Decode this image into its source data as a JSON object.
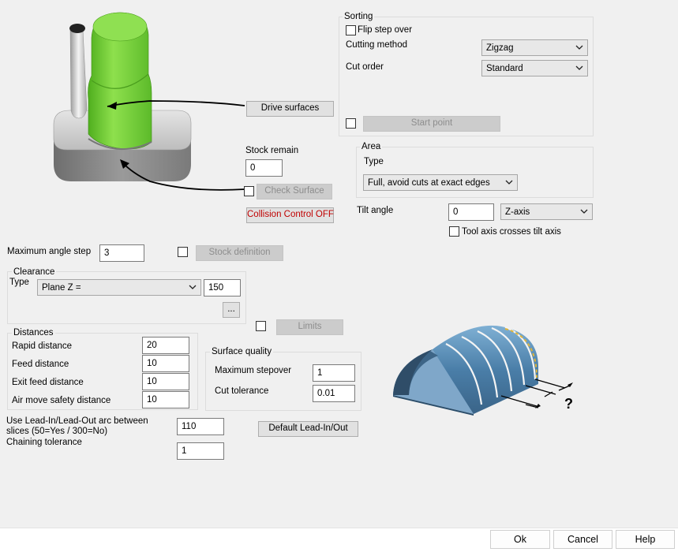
{
  "sorting": {
    "title": "Sorting",
    "flip_step_over": "Flip step over",
    "cutting_method_label": "Cutting method",
    "cutting_method_value": "Zigzag",
    "cut_order_label": "Cut order",
    "cut_order_value": "Standard",
    "start_point_button": "Start point"
  },
  "drive_surfaces_button": "Drive surfaces",
  "stock_remain": {
    "label": "Stock remain",
    "value": "0"
  },
  "check_surface_button": "Check Surface",
  "collision_control_button": "Collision Control OFF",
  "area": {
    "title": "Area",
    "type_label": "Type",
    "type_value": "Full, avoid cuts at exact edges"
  },
  "tilt": {
    "label": "Tilt angle",
    "value": "0",
    "axis_value": "Z-axis",
    "crosses_label": "Tool axis crosses tilt axis"
  },
  "max_angle_step": {
    "label": "Maximum angle step",
    "value": "3"
  },
  "stock_definition_button": "Stock definition",
  "clearance": {
    "title": "Clearance",
    "type_label": "Type",
    "type_value": "Plane Z =",
    "value": "150",
    "more_button": "..."
  },
  "limits_button": "Limits",
  "distances": {
    "title": "Distances",
    "rows": [
      {
        "label": "Rapid distance",
        "value": "20"
      },
      {
        "label": "Feed distance",
        "value": "10"
      },
      {
        "label": "Exit feed distance",
        "value": "10"
      },
      {
        "label": "Air move safety distance",
        "value": "10"
      }
    ]
  },
  "surface_quality": {
    "title": "Surface quality",
    "max_stepover_label": "Maximum stepover",
    "max_stepover_value": "1",
    "cut_tolerance_label": "Cut tolerance",
    "cut_tolerance_value": "0.01"
  },
  "lead_in": {
    "label": "Use Lead-In/Lead-Out arc between slices (50=Yes / 300=No)",
    "value": "110",
    "default_button": "Default Lead-In/Out"
  },
  "chaining": {
    "label": "Chaining tolerance",
    "value": "1"
  },
  "footer": {
    "ok": "Ok",
    "cancel": "Cancel",
    "help": "Help"
  },
  "illustration": {
    "question_mark": "?"
  },
  "colors": {
    "green": "#7ed63f",
    "steel_blue": "#4a7ea8",
    "disabled_text": "#8d8d8d",
    "warning_red": "#c00000"
  }
}
